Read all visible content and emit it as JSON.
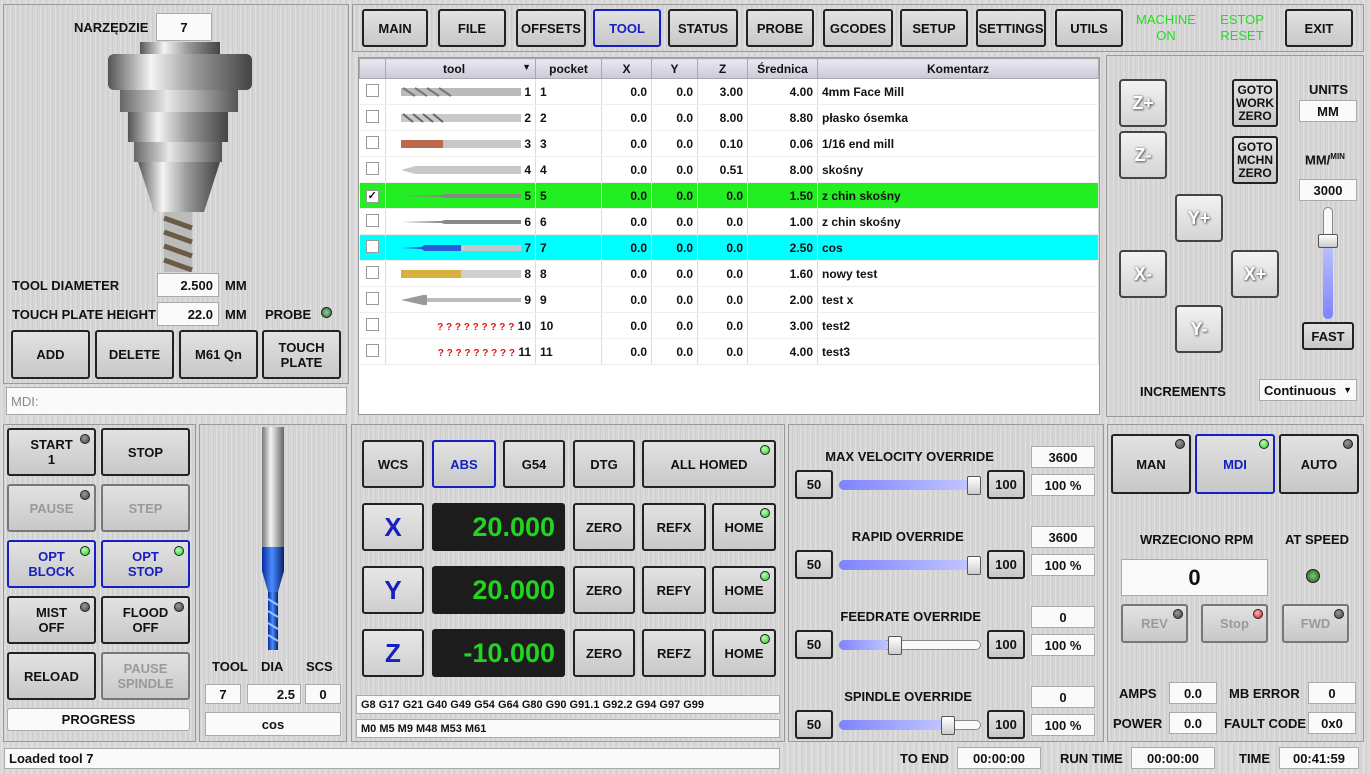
{
  "tool_panel": {
    "tool_label": "NARZĘDZIE",
    "tool_number": "7",
    "diameter_label": "TOOL DIAMETER",
    "diameter_value": "2.500",
    "diameter_unit": "MM",
    "plate_label": "TOUCH PLATE HEIGHT",
    "plate_value": "22.0",
    "plate_unit": "MM",
    "probe_label": "PROBE",
    "buttons": [
      "ADD",
      "DELETE",
      "M61 Qn",
      "TOUCH\nPLATE"
    ],
    "mdi_placeholder": "MDI:"
  },
  "nav": {
    "tabs": [
      "MAIN",
      "FILE",
      "OFFSETS",
      "TOOL",
      "STATUS",
      "PROBE",
      "GCODES",
      "SETUP",
      "SETTINGS",
      "UTILS"
    ],
    "active_tab": "TOOL",
    "machine_on": "MACHINE\nON",
    "estop": "ESTOP\nRESET",
    "exit": "EXIT",
    "status_color": "#22dd22"
  },
  "tool_table": {
    "columns": [
      "tool",
      "pocket",
      "X",
      "Y",
      "Z",
      "Średnica",
      "Komentarz"
    ],
    "rows": [
      {
        "checked": false,
        "tool": "1",
        "pocket": "1",
        "x": "0.0",
        "y": "0.0",
        "z": "3.00",
        "dia": "4.00",
        "comment": "4mm Face Mill",
        "img": "face"
      },
      {
        "checked": false,
        "tool": "2",
        "pocket": "2",
        "x": "0.0",
        "y": "0.0",
        "z": "8.00",
        "dia": "8.80",
        "comment": "płasko ósemka",
        "img": "flat"
      },
      {
        "checked": false,
        "tool": "3",
        "pocket": "3",
        "x": "0.0",
        "y": "0.0",
        "z": "0.10",
        "dia": "0.06",
        "comment": "1/16 end mill",
        "img": "copper"
      },
      {
        "checked": false,
        "tool": "4",
        "pocket": "4",
        "x": "0.0",
        "y": "0.0",
        "z": "0.51",
        "dia": "8.00",
        "comment": "skośny",
        "img": "drill"
      },
      {
        "checked": true,
        "tool": "5",
        "pocket": "5",
        "x": "0.0",
        "y": "0.0",
        "z": "0.0",
        "dia": "1.50",
        "comment": "z chin skośny",
        "img": "fine",
        "state": "sel"
      },
      {
        "checked": false,
        "tool": "6",
        "pocket": "6",
        "x": "0.0",
        "y": "0.0",
        "z": "0.0",
        "dia": "1.00",
        "comment": "z chin skośny",
        "img": "fine"
      },
      {
        "checked": false,
        "tool": "7",
        "pocket": "7",
        "x": "0.0",
        "y": "0.0",
        "z": "0.0",
        "dia": "2.50",
        "comment": "cos",
        "img": "blue",
        "state": "cur"
      },
      {
        "checked": false,
        "tool": "8",
        "pocket": "8",
        "x": "0.0",
        "y": "0.0",
        "z": "0.0",
        "dia": "1.60",
        "comment": "nowy test",
        "img": "gold"
      },
      {
        "checked": false,
        "tool": "9",
        "pocket": "9",
        "x": "0.0",
        "y": "0.0",
        "z": "0.0",
        "dia": "2.00",
        "comment": "test x",
        "img": "cham"
      },
      {
        "checked": false,
        "tool": "10",
        "pocket": "10",
        "x": "0.0",
        "y": "0.0",
        "z": "0.0",
        "dia": "3.00",
        "comment": "test2",
        "img": "q"
      },
      {
        "checked": false,
        "tool": "11",
        "pocket": "11",
        "x": "0.0",
        "y": "0.0",
        "z": "0.0",
        "dia": "4.00",
        "comment": "test3",
        "img": "q"
      }
    ],
    "missing_image": "? ? ? ? ? ? ? ? ?"
  },
  "jog": {
    "zplus": "Z+",
    "zminus": "Z-",
    "yplus": "Y+",
    "yminus": "Y-",
    "xminus": "X-",
    "xplus": "X+",
    "goto_work": "GOTO\nWORK\nZERO",
    "goto_mchn": "GOTO\nMCHN\nZERO",
    "units_label": "UNITS",
    "units_value": "MM",
    "rate_label": "MM/",
    "rate_sup": "MIN",
    "rate_value": "3000",
    "fast": "FAST",
    "increments_label": "INCREMENTS",
    "increments_value": "Continuous",
    "jog_slider_level": 0.72
  },
  "program": {
    "start": "START\n1",
    "stop": "STOP",
    "pause": "PAUSE",
    "step": "STEP",
    "opt_block": "OPT\nBLOCK",
    "opt_stop": "OPT\nSTOP",
    "mist": "MIST\nOFF",
    "flood": "FLOOD\nOFF",
    "reload": "RELOAD",
    "pause_spindle": "PAUSE\nSPINDLE",
    "progress": "PROGRESS"
  },
  "current_tool": {
    "tool_label": "TOOL",
    "dia_label": "DIA",
    "scs_label": "SCS",
    "tool": "7",
    "dia": "2.5",
    "scs": "0",
    "comment": "cos"
  },
  "dro": {
    "wcs": "WCS",
    "abs": "ABS",
    "g54": "G54",
    "dtg": "DTG",
    "all_homed": "ALL HOMED",
    "zero": "ZERO",
    "home": "HOME",
    "axes": [
      {
        "name": "X",
        "value": "20.000",
        "ref": "REFX"
      },
      {
        "name": "Y",
        "value": "20.000",
        "ref": "REFY"
      },
      {
        "name": "Z",
        "value": "-10.000",
        "ref": "REFZ"
      }
    ],
    "gcodes": "G8 G17 G21 G40 G49 G54 G64 G80 G90 G91.1 G92.2 G94 G97 G99",
    "mcodes": "M0 M5 M9 M48 M53 M61"
  },
  "overrides": [
    {
      "label": "MAX VELOCITY OVERRIDE",
      "value": "3600",
      "percent": "100 %",
      "min": "50",
      "max": "100",
      "level": 1.0
    },
    {
      "label": "RAPID OVERRIDE",
      "value": "3600",
      "percent": "100 %",
      "min": "50",
      "max": "100",
      "level": 1.0
    },
    {
      "label": "FEEDRATE OVERRIDE",
      "value": "0",
      "percent": "100 %",
      "min": "50",
      "max": "100",
      "level": 0.38
    },
    {
      "label": "SPINDLE OVERRIDE",
      "value": "0",
      "percent": "100 %",
      "min": "50",
      "max": "100",
      "level": 0.8
    }
  ],
  "mode": {
    "man": "MAN",
    "mdi": "MDI",
    "auto": "AUTO",
    "rpm_label": "WRZECIONO RPM",
    "at_speed": "AT SPEED",
    "rpm": "0",
    "rev": "REV",
    "stop": "Stop",
    "fwd": "FWD",
    "amps_label": "AMPS",
    "amps": "0.0",
    "mb_error_label": "MB ERROR",
    "mb_error": "0",
    "power_label": "POWER",
    "power": "0.0",
    "fault_label": "FAULT CODE",
    "fault": "0x0"
  },
  "status": {
    "message": "Loaded tool 7",
    "to_end_label": "TO END",
    "to_end": "00:00:00",
    "run_time_label": "RUN TIME",
    "run_time": "00:00:00",
    "time_label": "TIME",
    "time": "00:41:59"
  }
}
